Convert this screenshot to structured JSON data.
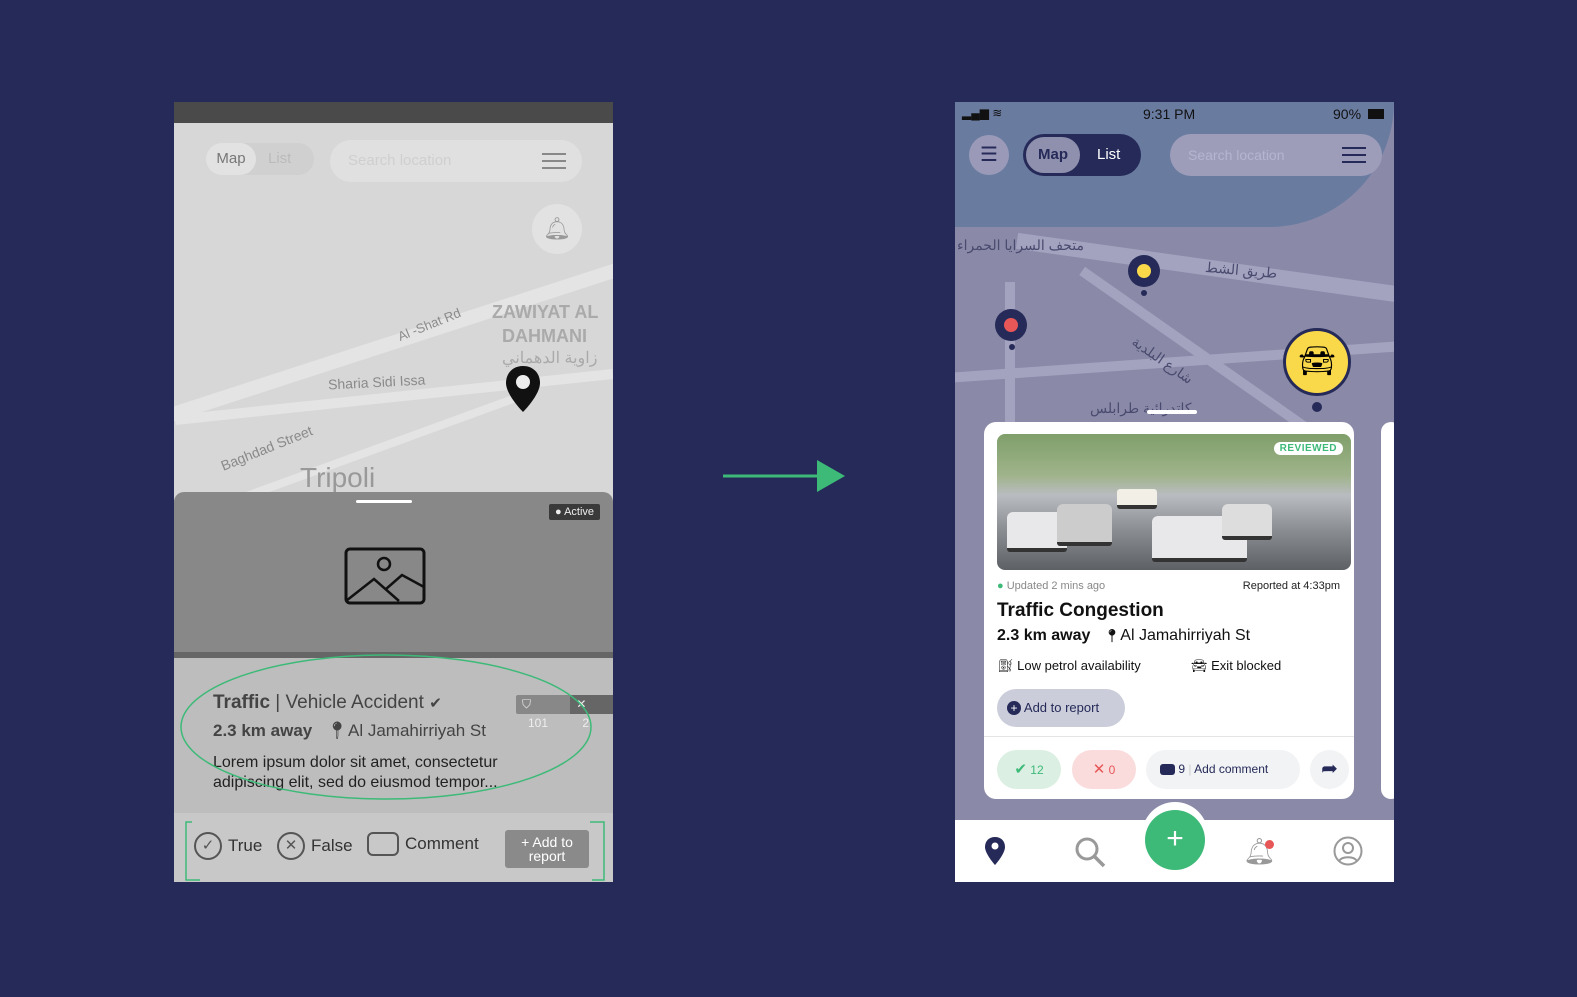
{
  "wireframe": {
    "toggle": {
      "map": "Map",
      "list": "List"
    },
    "search_placeholder": "Search location",
    "map_labels": [
      "ZAWIYAT AL",
      "DAHMANI",
      "زاوية الدهماني",
      "Al -Shat Rd",
      "Sharia Sidi Issa",
      "Baghdad Street",
      "Tripoli"
    ],
    "status_badge": "Active",
    "title_bold": "Traffic",
    "title_rest": " | Vehicle Accident",
    "distance": "2.3 km away",
    "street": "Al Jamahirriyah St",
    "description": "Lorem ipsum dolor sit amet, consectetur adipiscing elit, sed do eiusmod tempor...",
    "confirm_count": "101",
    "reject_count": "2",
    "actions": {
      "true": "True",
      "false": "False",
      "comment": "Comment",
      "add": "+ Add to report"
    }
  },
  "mockup": {
    "status_bar": {
      "time": "9:31 PM",
      "battery": "90%"
    },
    "toggle": {
      "map": "Map",
      "list": "List"
    },
    "search_placeholder": "Search location",
    "map_labels": [
      "متحف السرايا الحمراء",
      "طريق الشط",
      "شارع البلدية",
      "كاتدرائية طرابلس"
    ],
    "card": {
      "badge": "REVIEWED",
      "updated": "Updated 2 mins ago",
      "reported": "Reported at 4:33pm",
      "title": "Traffic Congestion",
      "distance": "2.3 km away",
      "street": "Al Jamahirriyah St",
      "tags": [
        "Low petrol availability",
        "Exit blocked"
      ],
      "add_to_report": "Add to report",
      "true_count": "12",
      "false_count": "0",
      "comment_count": "9",
      "add_comment": "Add comment"
    },
    "colors": {
      "navy": "#252a58",
      "green": "#3dba78",
      "red": "#e85757",
      "yellow": "#f9d84a"
    }
  }
}
